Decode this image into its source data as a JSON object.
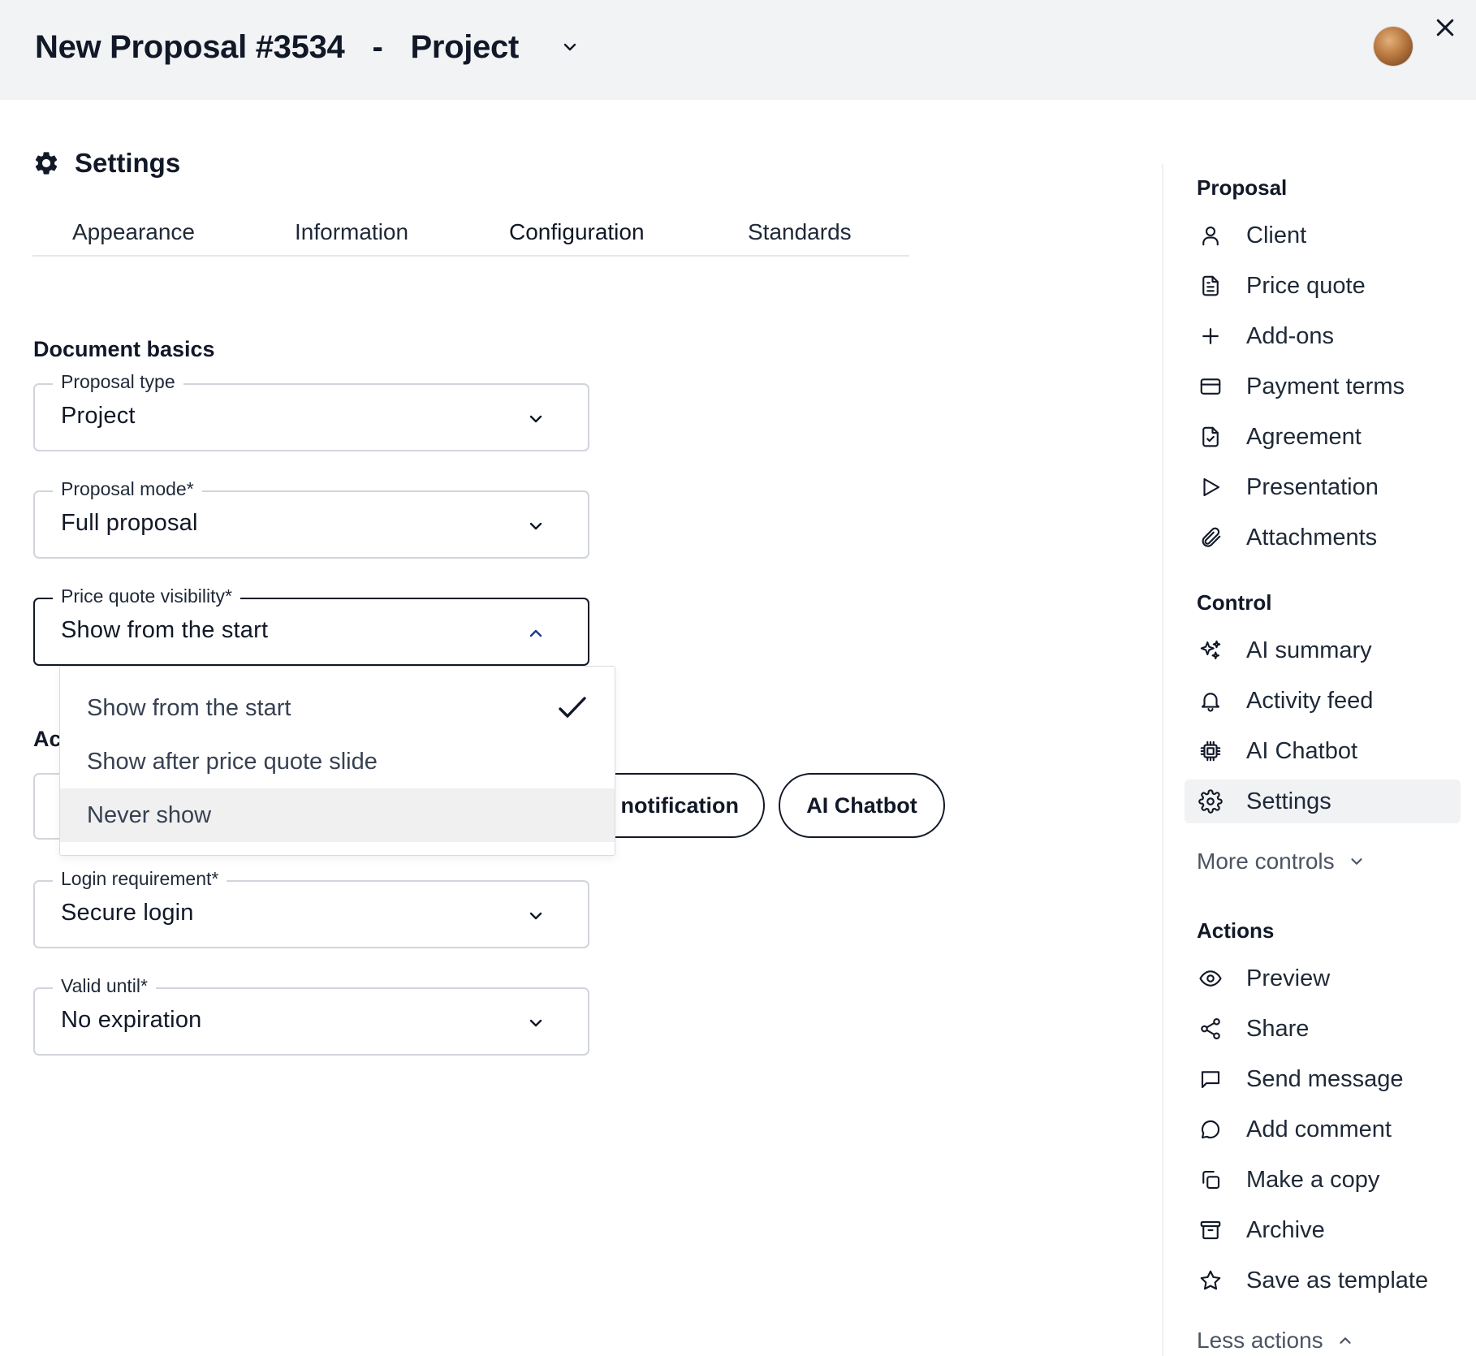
{
  "header": {
    "title": "New Proposal #3534",
    "separator": "-",
    "project": "Project"
  },
  "settings": {
    "heading": "Settings",
    "tabs": [
      "Appearance",
      "Information",
      "Configuration",
      "Standards"
    ],
    "active_tab": "Configuration"
  },
  "document_basics": {
    "title": "Document basics",
    "proposal_type": {
      "label": "Proposal type",
      "value": "Project"
    },
    "proposal_mode": {
      "label": "Proposal mode*",
      "value": "Full proposal"
    },
    "price_quote_visibility": {
      "label": "Price quote visibility*",
      "value": "Show from the start"
    }
  },
  "dropdown": {
    "options": [
      "Show from the start",
      "Show after price quote slide",
      "Never show"
    ],
    "selected": "Show from the start",
    "hovered": "Never show"
  },
  "addons_section": {
    "title_partial": "Ac",
    "chips": [
      "notification",
      "AI Chatbot"
    ]
  },
  "more_fields": {
    "login_requirement": {
      "label": "Login requirement*",
      "value": "Secure login"
    },
    "valid_until": {
      "label": "Valid until*",
      "value": "No expiration"
    }
  },
  "sidebar": {
    "proposal": {
      "title": "Proposal",
      "items": [
        {
          "label": "Client",
          "icon": "user-icon"
        },
        {
          "label": "Price quote",
          "icon": "document-icon"
        },
        {
          "label": "Add-ons",
          "icon": "plus-icon"
        },
        {
          "label": "Payment terms",
          "icon": "credit-card-icon"
        },
        {
          "label": "Agreement",
          "icon": "document-check-icon"
        },
        {
          "label": "Presentation",
          "icon": "play-icon"
        },
        {
          "label": "Attachments",
          "icon": "paperclip-icon"
        }
      ]
    },
    "control": {
      "title": "Control",
      "items": [
        {
          "label": "AI summary",
          "icon": "sparkles-icon"
        },
        {
          "label": "Activity feed",
          "icon": "bell-icon"
        },
        {
          "label": "AI Chatbot",
          "icon": "chip-icon"
        },
        {
          "label": "Settings",
          "icon": "gear-icon"
        }
      ],
      "more": "More controls"
    },
    "actions": {
      "title": "Actions",
      "items": [
        {
          "label": "Preview",
          "icon": "eye-icon"
        },
        {
          "label": "Share",
          "icon": "share-icon"
        },
        {
          "label": "Send message",
          "icon": "message-square-icon"
        },
        {
          "label": "Add comment",
          "icon": "comment-icon"
        },
        {
          "label": "Make a copy",
          "icon": "copy-icon"
        },
        {
          "label": "Archive",
          "icon": "archive-icon"
        },
        {
          "label": "Save as template",
          "icon": "star-icon"
        }
      ],
      "less": "Less actions"
    }
  }
}
